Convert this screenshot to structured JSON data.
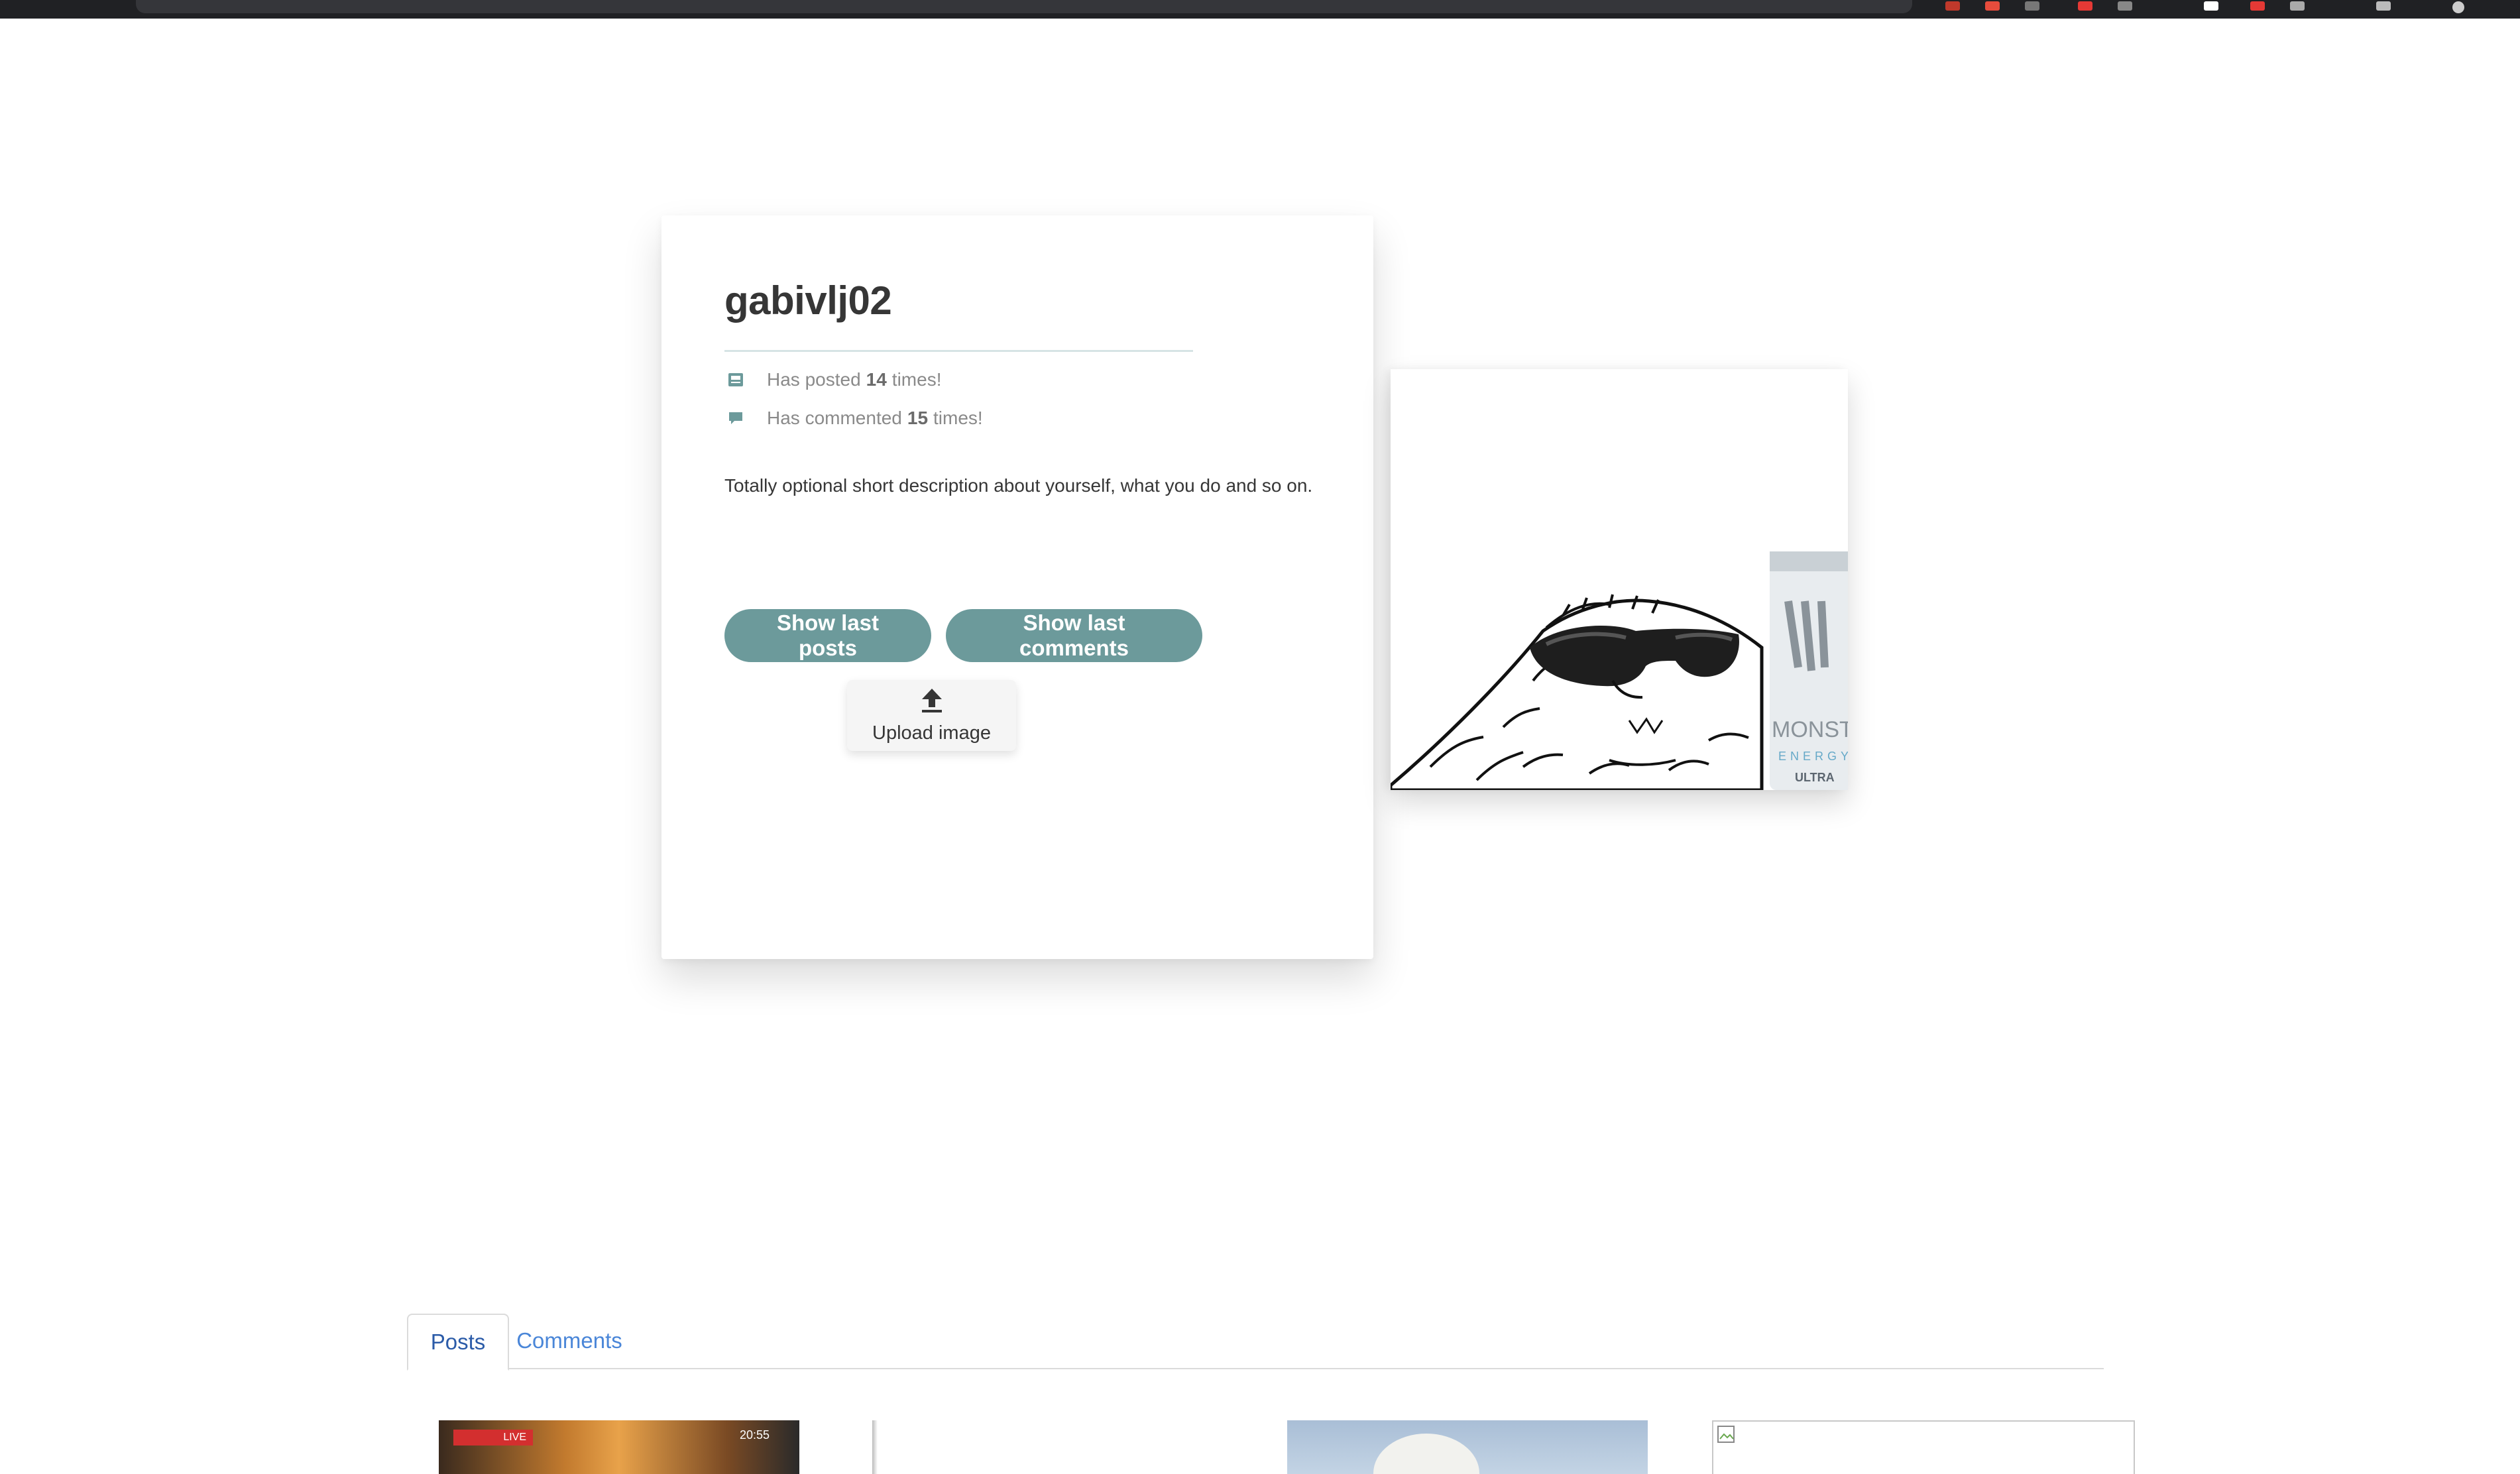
{
  "profile": {
    "username": "gabivlj02",
    "posts_prefix": "Has posted",
    "posts_count": "14",
    "posts_suffix": "times!",
    "comments_prefix": "Has commented",
    "comments_count": "15",
    "comments_suffix": "times!",
    "description": "Totally optional short description about yourself, what you do and so on.",
    "show_posts_label": "Show last posts",
    "show_comments_label": "Show last comments",
    "upload_label": "Upload image"
  },
  "avatar": {
    "can_brand": "MONSTER",
    "can_subbrand": "ENERGY",
    "can_variant": "ULTRA"
  },
  "tabs": [
    {
      "label": "Posts",
      "active": true
    },
    {
      "label": "Comments",
      "active": false
    }
  ],
  "thumbnails": [
    {
      "kind": "video-still",
      "badge": "LIVE",
      "timer": "20:55"
    },
    {
      "kind": "blank"
    },
    {
      "kind": "photo"
    },
    {
      "kind": "broken-image"
    }
  ],
  "colors": {
    "button": "#6c9a9b",
    "tab_link": "#3273dc",
    "muted": "#8a8a8a"
  }
}
